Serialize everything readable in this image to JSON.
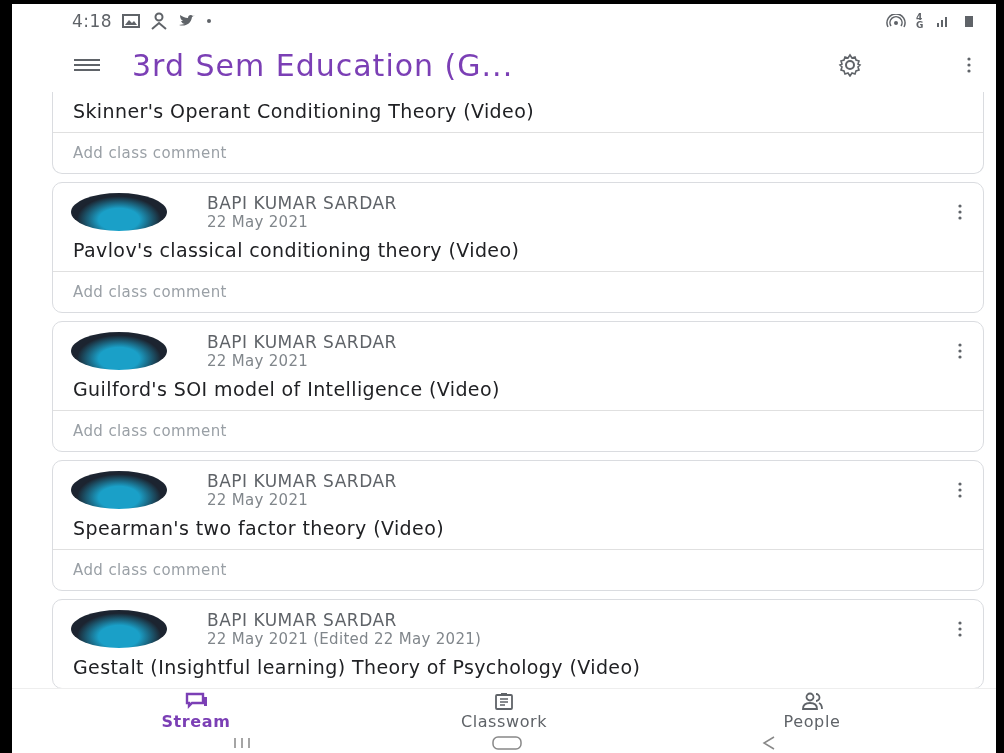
{
  "status_bar": {
    "time": "4:18",
    "network": "4G"
  },
  "app_bar": {
    "title": "3rd Sem Education (G..."
  },
  "posts": [
    {
      "title": "Skinner's Operant Conditioning Theory (Video)",
      "comment": {
        "placeholder": "Add class comment"
      }
    },
    {
      "author": "BAPI KUMAR SARDAR",
      "date": "22 May 2021",
      "title": "Pavlov's classical conditioning theory (Video)",
      "comment": {
        "placeholder": "Add class comment"
      }
    },
    {
      "author": "BAPI KUMAR SARDAR",
      "date": "22 May 2021",
      "title": "Guilford's SOI model of Intelligence (Video)",
      "comment": {
        "placeholder": "Add class comment"
      }
    },
    {
      "author": "BAPI KUMAR SARDAR",
      "date": "22 May 2021",
      "title": "Spearman's two factor theory (Video)",
      "comment": {
        "placeholder": "Add class comment"
      }
    },
    {
      "author": "BAPI KUMAR SARDAR",
      "date": "22 May 2021 (Edited 22 May 2021)",
      "title": "Gestalt (Insightful learning) Theory of Psychology (Video)"
    }
  ],
  "bottom_nav": [
    {
      "kind": "stream",
      "label": "Stream",
      "selected": true
    },
    {
      "kind": "classwork",
      "label": "Classwork",
      "selected": false
    },
    {
      "kind": "people",
      "label": "People",
      "selected": false
    }
  ]
}
